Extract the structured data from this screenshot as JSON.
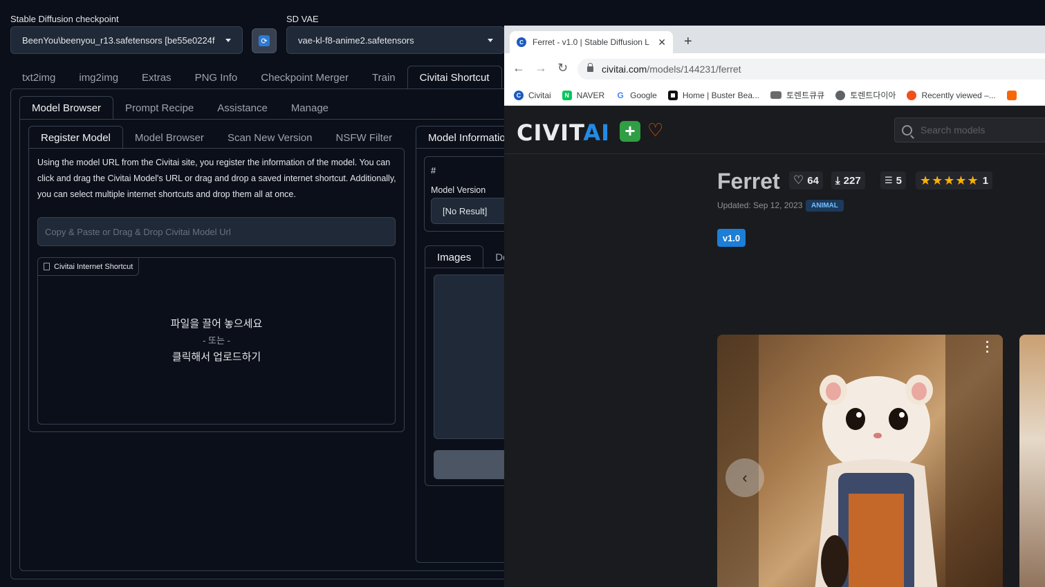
{
  "gradio": {
    "checkpoint": {
      "label": "Stable Diffusion checkpoint",
      "value": "BeenYou\\beenyou_r13.safetensors [be55e0224f"
    },
    "vae": {
      "label": "SD VAE",
      "value": "vae-kl-f8-anime2.safetensors"
    },
    "main_tabs": [
      "txt2img",
      "img2img",
      "Extras",
      "PNG Info",
      "Checkpoint Merger",
      "Train",
      "Civitai Shortcut"
    ],
    "sub_tabs": [
      "Model Browser",
      "Prompt Recipe",
      "Assistance",
      "Manage"
    ],
    "inner_tabs": [
      "Register Model",
      "Model Browser",
      "Scan New Version",
      "NSFW Filter"
    ],
    "description": "Using the model URL from the Civitai site, you register the information of the model. You can click and drag the Civitai Model's URL or drag and drop a saved internet shortcut. Additionally, you can select multiple internet shortcuts and drop them all at once.",
    "url_input_placeholder": "Copy & Paste or Drag & Drop Civitai Model Url",
    "file_label": "Civitai Internet Shortcut",
    "drop": {
      "line1": "파일을 끌어 놓으세요",
      "or": "- 또는 -",
      "line2": "클릭해서 업로드하기"
    },
    "model_info": {
      "title": "Model Informatio",
      "hash": "#",
      "version_label": "Model Version",
      "version_value": "[No Result]",
      "tabs": [
        "Images",
        "De"
      ]
    }
  },
  "browser": {
    "tab_title": "Ferret - v1.0 | Stable Diffusion L",
    "url_domain": "civitai.com",
    "url_path": "/models/144231/ferret",
    "bookmarks": [
      {
        "label": "Civitai",
        "icon": "civitai-icon",
        "color": "#1c5bbf",
        "glyph": "C"
      },
      {
        "label": "NAVER",
        "icon": "naver-icon",
        "color": "#03c75a",
        "glyph": "N"
      },
      {
        "label": "Google",
        "icon": "google-icon",
        "color": "#ffffff",
        "glyph": "G"
      },
      {
        "label": "Home | Buster Bea...",
        "icon": "buster-icon",
        "color": "#111111",
        "glyph": "■"
      },
      {
        "label": "토렌트큐큐",
        "icon": "torrent-icon",
        "color": "#5a5a5a",
        "glyph": "▭"
      },
      {
        "label": "토렌트다이아",
        "icon": "globe-icon",
        "color": "#5f6368",
        "glyph": "◉"
      },
      {
        "label": "Recently viewed –...",
        "icon": "figma-icon",
        "color": "#f24e1e",
        "glyph": "F"
      }
    ],
    "civitai": {
      "logo_main": "CIVIT",
      "logo_ai": "AI",
      "search_placeholder": "Search models",
      "model_name": "Ferret",
      "likes": "64",
      "downloads": "227",
      "comments": "5",
      "rating_count": "1",
      "updated": "Updated: Sep 12, 2023",
      "category": "ANIMAL",
      "version": "v1.0"
    }
  }
}
